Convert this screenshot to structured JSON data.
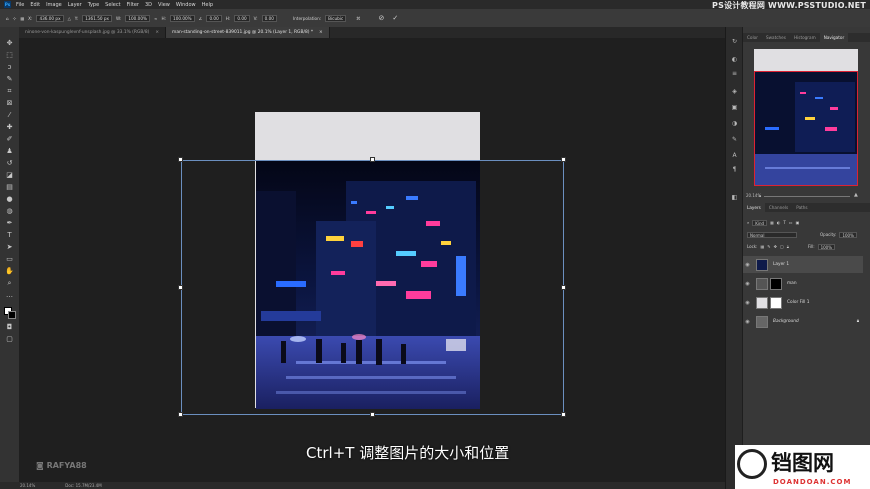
{
  "menubar": {
    "app_logo": "Ps",
    "items": [
      "File",
      "Edit",
      "Image",
      "Layer",
      "Type",
      "Select",
      "Filter",
      "3D",
      "View",
      "Window",
      "Help"
    ],
    "watermark": "PS设计教程网 WWW.PSSTUDIO.NET"
  },
  "options": {
    "x_label": "X:",
    "x_value": "436.00 px",
    "y_label": "Y:",
    "y_value": "1361.50 px",
    "w_label": "W:",
    "w_value": "100.00%",
    "h_label": "H:",
    "h_value": "100.00%",
    "angle_label": "∠",
    "angle_value": "0.00",
    "h_skew_label": "H:",
    "h_skew_value": "0.00",
    "v_skew_label": "V:",
    "v_skew_value": "0.00",
    "interpolation_label": "Interpolation:",
    "interpolation_value": "Bicubic"
  },
  "tabs": [
    {
      "label": "ninone-von-kaspunglevnf-unsplash.jpg @ 33.1% (RGB/8)",
      "close": "×"
    },
    {
      "label": "man-standing-on-street-839011.jpg @ 20.1% (Layer 1, RGB/8) *",
      "close": "×"
    }
  ],
  "subtitle": "Ctrl+T 调整图片的大小和位置",
  "channel_watermark": "RAFYA88",
  "status": {
    "zoom": "20.14%",
    "doc": "Doc: 15.7M/23.4M"
  },
  "navigator": {
    "tabs": [
      "Color",
      "Swatches",
      "Histogram",
      "Navigator"
    ],
    "zoom": "20.14%"
  },
  "layers_panel": {
    "tabs": [
      "Layers",
      "Channels",
      "Paths"
    ],
    "kind_label": "Kind",
    "blend_mode": "Normal",
    "opacity_label": "Opacity:",
    "opacity_value": "100%",
    "lock_label": "Lock:",
    "fill_label": "Fill:",
    "fill_value": "100%",
    "layers": [
      {
        "name": "Layer 1",
        "selected": true
      },
      {
        "name": "man",
        "selected": false
      },
      {
        "name": "Color Fill 1",
        "selected": false
      },
      {
        "name": "Background",
        "selected": false
      }
    ]
  },
  "site_logo": {
    "main": "铛图网",
    "sub": "DOANDOAN.COM"
  },
  "colors": {
    "accent": "#31a8ff",
    "selection": "#6b8fbf",
    "neon_pink": "#ff3c9c",
    "neon_blue": "#3a7bff"
  },
  "icons": [
    "move-icon",
    "marquee-icon",
    "lasso-icon",
    "quick-select-icon",
    "crop-icon",
    "frame-icon",
    "eyedropper-icon",
    "heal-icon",
    "brush-icon",
    "stamp-icon",
    "history-brush-icon",
    "eraser-icon",
    "gradient-icon",
    "blur-icon",
    "dodge-icon",
    "pen-icon",
    "type-icon",
    "path-select-icon",
    "shape-icon",
    "hand-icon",
    "zoom-icon",
    "more-tools-icon"
  ]
}
